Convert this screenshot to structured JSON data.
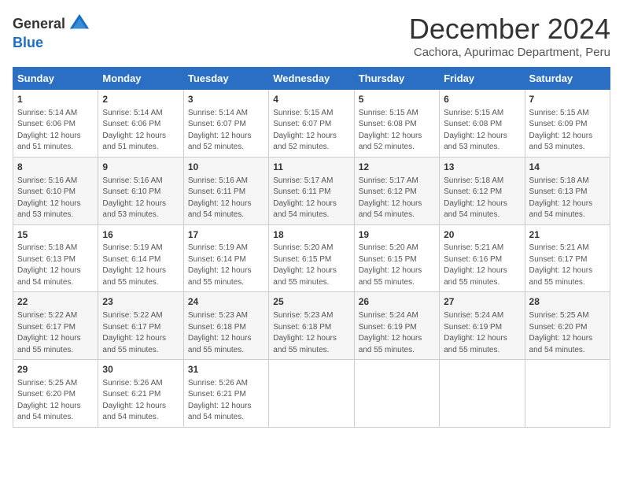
{
  "logo": {
    "general": "General",
    "blue": "Blue"
  },
  "title": "December 2024",
  "subtitle": "Cachora, Apurimac Department, Peru",
  "days_of_week": [
    "Sunday",
    "Monday",
    "Tuesday",
    "Wednesday",
    "Thursday",
    "Friday",
    "Saturday"
  ],
  "weeks": [
    [
      {
        "day": "1",
        "sunrise": "5:14 AM",
        "sunset": "6:06 PM",
        "daylight": "12 hours and 51 minutes."
      },
      {
        "day": "2",
        "sunrise": "5:14 AM",
        "sunset": "6:06 PM",
        "daylight": "12 hours and 51 minutes."
      },
      {
        "day": "3",
        "sunrise": "5:14 AM",
        "sunset": "6:07 PM",
        "daylight": "12 hours and 52 minutes."
      },
      {
        "day": "4",
        "sunrise": "5:15 AM",
        "sunset": "6:07 PM",
        "daylight": "12 hours and 52 minutes."
      },
      {
        "day": "5",
        "sunrise": "5:15 AM",
        "sunset": "6:08 PM",
        "daylight": "12 hours and 52 minutes."
      },
      {
        "day": "6",
        "sunrise": "5:15 AM",
        "sunset": "6:08 PM",
        "daylight": "12 hours and 53 minutes."
      },
      {
        "day": "7",
        "sunrise": "5:15 AM",
        "sunset": "6:09 PM",
        "daylight": "12 hours and 53 minutes."
      }
    ],
    [
      {
        "day": "8",
        "sunrise": "5:16 AM",
        "sunset": "6:10 PM",
        "daylight": "12 hours and 53 minutes."
      },
      {
        "day": "9",
        "sunrise": "5:16 AM",
        "sunset": "6:10 PM",
        "daylight": "12 hours and 53 minutes."
      },
      {
        "day": "10",
        "sunrise": "5:16 AM",
        "sunset": "6:11 PM",
        "daylight": "12 hours and 54 minutes."
      },
      {
        "day": "11",
        "sunrise": "5:17 AM",
        "sunset": "6:11 PM",
        "daylight": "12 hours and 54 minutes."
      },
      {
        "day": "12",
        "sunrise": "5:17 AM",
        "sunset": "6:12 PM",
        "daylight": "12 hours and 54 minutes."
      },
      {
        "day": "13",
        "sunrise": "5:18 AM",
        "sunset": "6:12 PM",
        "daylight": "12 hours and 54 minutes."
      },
      {
        "day": "14",
        "sunrise": "5:18 AM",
        "sunset": "6:13 PM",
        "daylight": "12 hours and 54 minutes."
      }
    ],
    [
      {
        "day": "15",
        "sunrise": "5:18 AM",
        "sunset": "6:13 PM",
        "daylight": "12 hours and 54 minutes."
      },
      {
        "day": "16",
        "sunrise": "5:19 AM",
        "sunset": "6:14 PM",
        "daylight": "12 hours and 55 minutes."
      },
      {
        "day": "17",
        "sunrise": "5:19 AM",
        "sunset": "6:14 PM",
        "daylight": "12 hours and 55 minutes."
      },
      {
        "day": "18",
        "sunrise": "5:20 AM",
        "sunset": "6:15 PM",
        "daylight": "12 hours and 55 minutes."
      },
      {
        "day": "19",
        "sunrise": "5:20 AM",
        "sunset": "6:15 PM",
        "daylight": "12 hours and 55 minutes."
      },
      {
        "day": "20",
        "sunrise": "5:21 AM",
        "sunset": "6:16 PM",
        "daylight": "12 hours and 55 minutes."
      },
      {
        "day": "21",
        "sunrise": "5:21 AM",
        "sunset": "6:17 PM",
        "daylight": "12 hours and 55 minutes."
      }
    ],
    [
      {
        "day": "22",
        "sunrise": "5:22 AM",
        "sunset": "6:17 PM",
        "daylight": "12 hours and 55 minutes."
      },
      {
        "day": "23",
        "sunrise": "5:22 AM",
        "sunset": "6:17 PM",
        "daylight": "12 hours and 55 minutes."
      },
      {
        "day": "24",
        "sunrise": "5:23 AM",
        "sunset": "6:18 PM",
        "daylight": "12 hours and 55 minutes."
      },
      {
        "day": "25",
        "sunrise": "5:23 AM",
        "sunset": "6:18 PM",
        "daylight": "12 hours and 55 minutes."
      },
      {
        "day": "26",
        "sunrise": "5:24 AM",
        "sunset": "6:19 PM",
        "daylight": "12 hours and 55 minutes."
      },
      {
        "day": "27",
        "sunrise": "5:24 AM",
        "sunset": "6:19 PM",
        "daylight": "12 hours and 55 minutes."
      },
      {
        "day": "28",
        "sunrise": "5:25 AM",
        "sunset": "6:20 PM",
        "daylight": "12 hours and 54 minutes."
      }
    ],
    [
      {
        "day": "29",
        "sunrise": "5:25 AM",
        "sunset": "6:20 PM",
        "daylight": "12 hours and 54 minutes."
      },
      {
        "day": "30",
        "sunrise": "5:26 AM",
        "sunset": "6:21 PM",
        "daylight": "12 hours and 54 minutes."
      },
      {
        "day": "31",
        "sunrise": "5:26 AM",
        "sunset": "6:21 PM",
        "daylight": "12 hours and 54 minutes."
      },
      null,
      null,
      null,
      null
    ]
  ],
  "labels": {
    "sunrise": "Sunrise:",
    "sunset": "Sunset:",
    "daylight": "Daylight:"
  }
}
